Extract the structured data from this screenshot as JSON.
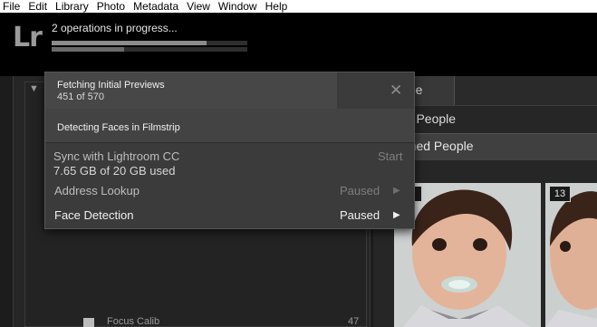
{
  "menubar": {
    "items": [
      "File",
      "Edit",
      "Library",
      "Photo",
      "Metadata",
      "View",
      "Window",
      "Help"
    ]
  },
  "identity_plate": {
    "logo": "Lr",
    "operations_text": "2 operations in progress...",
    "progress": [
      0.79,
      0.37
    ]
  },
  "popover": {
    "tasks": [
      {
        "title": "Fetching Initial Previews",
        "detail": "451 of 570"
      },
      {
        "title": "Detecting Faces in Filmstrip"
      }
    ],
    "close_icon": "close-icon",
    "sync": {
      "title": "Sync with Lightroom CC",
      "usage": "7.65 GB of 20 GB used",
      "action": "Start"
    },
    "address_lookup": {
      "title": "Address Lookup",
      "status": "Paused"
    },
    "face_detection": {
      "title": "Face Detection",
      "status": "Paused"
    }
  },
  "people_view": {
    "tab_label": "ople",
    "named_section": "ed People",
    "unnamed_section": "amed People",
    "thumbnails": [
      {
        "count": ""
      },
      {
        "count": "13"
      }
    ]
  },
  "folder_row": {
    "label": "Focus Calib",
    "count": "47"
  }
}
